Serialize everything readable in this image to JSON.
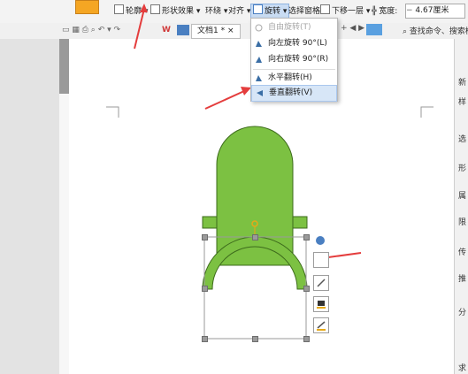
{
  "ribbon": {
    "outline_label": "轮廓",
    "shape_effect_label": "形状效果",
    "wrap_label": "环绕",
    "align_label": "对齐",
    "rotate_label": "旋转",
    "selection_pane_label": "选择窗格",
    "send_backward_label": "下移一层",
    "width_label": "宽度:",
    "width_value": "4.67厘米"
  },
  "qbar": {
    "doc_tab": "文档1 *",
    "search_placeholder": "查找命令、搜索模"
  },
  "rotate_menu": {
    "items": [
      {
        "label": "自由旋转(T)",
        "enabled": false
      },
      {
        "label": "向左旋转 90°(L)",
        "enabled": true
      },
      {
        "label": "向右旋转 90°(R)",
        "enabled": true
      },
      {
        "label": "水平翻转(H)",
        "enabled": true
      },
      {
        "label": "垂直翻转(V)",
        "enabled": true,
        "hovered": true
      }
    ]
  },
  "right_panel": {
    "items": [
      "新",
      "样",
      "选",
      "形",
      "属",
      "限",
      "传",
      "推",
      "分",
      "求"
    ]
  },
  "colors": {
    "shape_fill": "#7cc142",
    "shape_stroke": "#3d6b1c",
    "arrow": "#e43d3d",
    "accent": "#4a7fc1"
  }
}
